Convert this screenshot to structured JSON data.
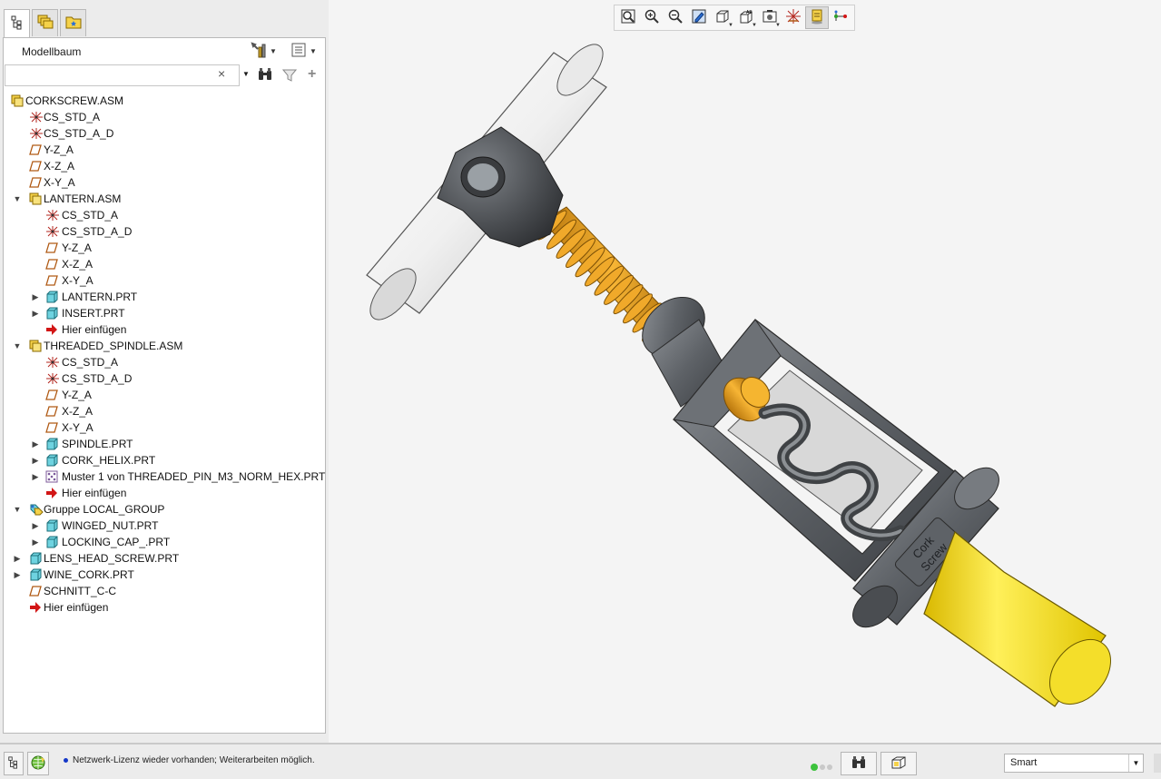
{
  "panel": {
    "tabs": [
      {
        "name": "model-tree-tab",
        "icon": "model-tree-icon"
      },
      {
        "name": "layers-tab",
        "icon": "layers-icon"
      },
      {
        "name": "favorites-tab",
        "icon": "star-folder-icon"
      }
    ],
    "title": "Modellbaum",
    "search": {
      "value": "",
      "placeholder": "",
      "clear": "×"
    }
  },
  "tree": {
    "rows": [
      {
        "label": "CORKSCREW.ASM",
        "icon": "assembly-icon",
        "level": 0,
        "toggle": ""
      },
      {
        "label": "CS_STD_A",
        "icon": "coordinate-system-icon",
        "level": 1,
        "toggle": ""
      },
      {
        "label": "CS_STD_A_D",
        "icon": "coordinate-system-icon",
        "level": 1,
        "toggle": ""
      },
      {
        "label": "Y-Z_A",
        "icon": "datum-plane-icon",
        "level": 1,
        "toggle": ""
      },
      {
        "label": "X-Z_A",
        "icon": "datum-plane-icon",
        "level": 1,
        "toggle": ""
      },
      {
        "label": "X-Y_A",
        "icon": "datum-plane-icon",
        "level": 1,
        "toggle": ""
      },
      {
        "label": "LANTERN.ASM",
        "icon": "assembly-icon",
        "level": 1,
        "toggle": "expanded"
      },
      {
        "label": "CS_STD_A",
        "icon": "coordinate-system-icon",
        "level": 2,
        "toggle": ""
      },
      {
        "label": "CS_STD_A_D",
        "icon": "coordinate-system-icon",
        "level": 2,
        "toggle": ""
      },
      {
        "label": "Y-Z_A",
        "icon": "datum-plane-icon",
        "level": 2,
        "toggle": ""
      },
      {
        "label": "X-Z_A",
        "icon": "datum-plane-icon",
        "level": 2,
        "toggle": ""
      },
      {
        "label": "X-Y_A",
        "icon": "datum-plane-icon",
        "level": 2,
        "toggle": ""
      },
      {
        "label": "LANTERN.PRT",
        "icon": "part-icon",
        "level": 2,
        "toggle": "collapsed"
      },
      {
        "label": "INSERT.PRT",
        "icon": "part-icon",
        "level": 2,
        "toggle": "collapsed"
      },
      {
        "label": "Hier einfügen",
        "icon": "insert-here-arrow-icon",
        "level": 2,
        "toggle": ""
      },
      {
        "label": "THREADED_SPINDLE.ASM",
        "icon": "assembly-icon",
        "level": 1,
        "toggle": "expanded"
      },
      {
        "label": "CS_STD_A",
        "icon": "coordinate-system-icon",
        "level": 2,
        "toggle": ""
      },
      {
        "label": "CS_STD_A_D",
        "icon": "coordinate-system-icon",
        "level": 2,
        "toggle": ""
      },
      {
        "label": "Y-Z_A",
        "icon": "datum-plane-icon",
        "level": 2,
        "toggle": ""
      },
      {
        "label": "X-Z_A",
        "icon": "datum-plane-icon",
        "level": 2,
        "toggle": ""
      },
      {
        "label": "X-Y_A",
        "icon": "datum-plane-icon",
        "level": 2,
        "toggle": ""
      },
      {
        "label": "SPINDLE.PRT",
        "icon": "part-icon",
        "level": 2,
        "toggle": "collapsed"
      },
      {
        "label": "CORK_HELIX.PRT",
        "icon": "part-icon",
        "level": 2,
        "toggle": "collapsed"
      },
      {
        "label": "Muster 1 von THREADED_PIN_M3_NORM_HEX.PRT",
        "icon": "pattern-icon",
        "level": 2,
        "toggle": "collapsed"
      },
      {
        "label": "Hier einfügen",
        "icon": "insert-here-arrow-icon",
        "level": 2,
        "toggle": ""
      },
      {
        "label": "Gruppe LOCAL_GROUP",
        "icon": "group-icon",
        "level": 1,
        "toggle": "expanded"
      },
      {
        "label": "WINGED_NUT.PRT",
        "icon": "part-icon",
        "level": 2,
        "toggle": "collapsed"
      },
      {
        "label": "LOCKING_CAP_.PRT",
        "icon": "part-icon",
        "level": 2,
        "toggle": "collapsed"
      },
      {
        "label": "LENS_HEAD_SCREW.PRT",
        "icon": "part-icon",
        "level": 1,
        "toggle": "collapsed"
      },
      {
        "label": "WINE_CORK.PRT",
        "icon": "part-icon",
        "level": 1,
        "toggle": "collapsed"
      },
      {
        "label": "SCHNITT_C-C",
        "icon": "datum-plane-icon",
        "level": 1,
        "toggle": ""
      },
      {
        "label": "Hier einfügen",
        "icon": "insert-here-arrow-icon",
        "level": 1,
        "toggle": ""
      }
    ]
  },
  "graphics_toolbar": {
    "buttons": [
      {
        "name": "refit-icon"
      },
      {
        "name": "zoom-in-icon"
      },
      {
        "name": "zoom-out-icon"
      },
      {
        "name": "repaint-icon"
      },
      {
        "name": "display-style-icon"
      },
      {
        "name": "saved-orientations-icon"
      },
      {
        "name": "view-manager-icon"
      },
      {
        "name": "datum-display-filters-icon"
      },
      {
        "name": "annotation-display-icon"
      },
      {
        "name": "spin-center-icon"
      }
    ]
  },
  "model": {
    "label_line1": "Cork",
    "label_line2": "Screw"
  },
  "status": {
    "message": "Netzwerk-Lizenz wieder vorhanden; Weiterarbeiten möglich.",
    "filter_value": "Smart"
  },
  "colors": {
    "accent_blue": "#1437c8",
    "spring_orange": "#e39b1b",
    "cork_yellow": "#f2d312",
    "body_gray": "#5d6166",
    "insert_arrow": "#d21515"
  }
}
